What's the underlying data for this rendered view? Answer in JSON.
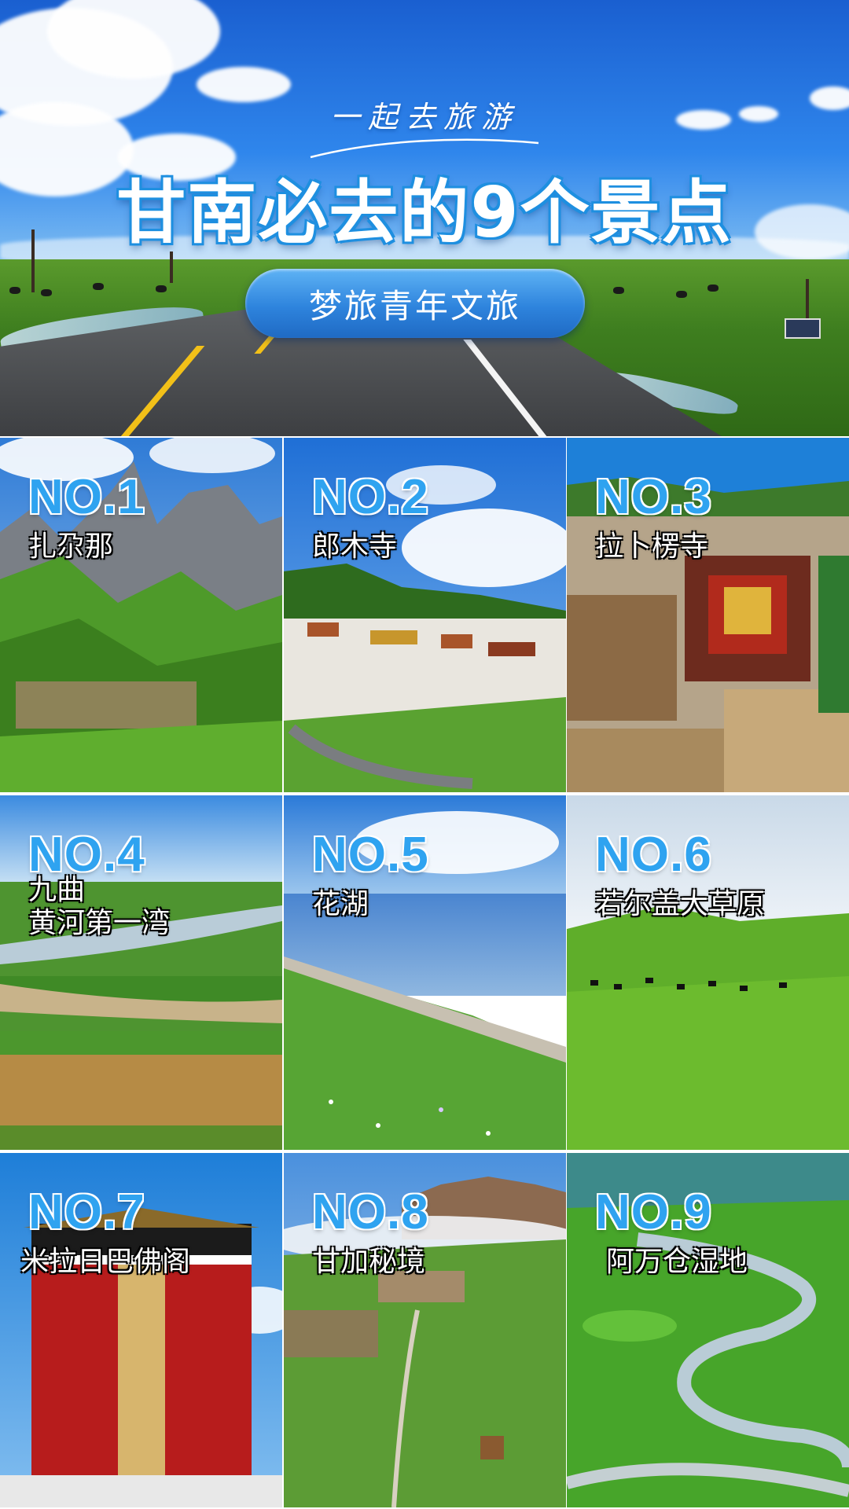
{
  "header": {
    "tagline": "一起去旅游",
    "title": "甘南必去的9个景点",
    "brand": "梦旅青年文旅"
  },
  "spots": [
    {
      "rank": "NO.1",
      "name": "扎尕那"
    },
    {
      "rank": "NO.2",
      "name": "郎木寺"
    },
    {
      "rank": "NO.3",
      "name": "拉卜楞寺"
    },
    {
      "rank": "NO.4",
      "name_line1": "九曲",
      "name_line2": "黄河第一湾"
    },
    {
      "rank": "NO.5",
      "name": "花湖"
    },
    {
      "rank": "NO.6",
      "name": "若尔盖大草原"
    },
    {
      "rank": "NO.7",
      "name": "米拉日巴佛阁"
    },
    {
      "rank": "NO.8",
      "name": "甘加秘境"
    },
    {
      "rank": "NO.9",
      "name": "阿万仓湿地"
    }
  ],
  "colors": {
    "rank_blue": "#2fa3f0",
    "title_outline": "#1e8fe0",
    "pill_blue": "#2e84dd"
  }
}
